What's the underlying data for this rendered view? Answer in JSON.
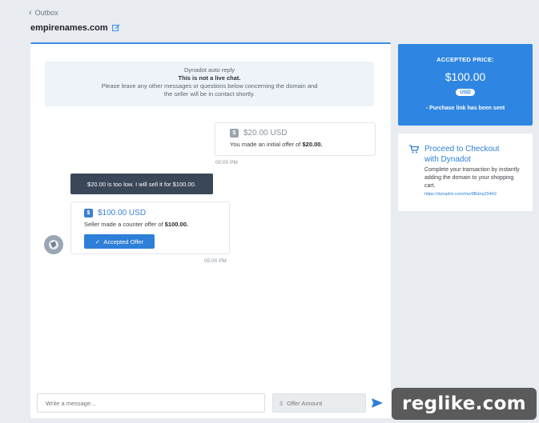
{
  "nav": {
    "back_label": "Outbox"
  },
  "header": {
    "domain": "empirenames.com"
  },
  "chat": {
    "auto_reply": {
      "title": "Dynadot auto reply",
      "notice": "This is not a live chat.",
      "body_line1": "Please leave any other messages or questions below concerning the domain and",
      "body_line2": "the seller will be in contact shortly."
    },
    "buyer_offer": {
      "price": "$20.00 USD",
      "text_prefix": "You made an initial offer of ",
      "text_amount": "$20.00.",
      "time": "00:00 PM"
    },
    "seller_message": "$20.00 is too low. I will sell it for $100.00.",
    "counter_offer": {
      "price": "$100.00 USD",
      "text_prefix": "Seller made a counter offer of ",
      "text_amount": "$100.00.",
      "button_label": "Accepted Offer",
      "time": "05:00 PM"
    },
    "composer": {
      "message_placeholder": "Write a message...",
      "offer_placeholder": "Offer Amount",
      "currency_symbol": "$"
    }
  },
  "sidebar": {
    "accepted": {
      "label": "ACCEPTED PRICE:",
      "amount": "$100.00",
      "currency": "USD",
      "status": "- Purchase link has been sent"
    },
    "checkout": {
      "title_line1": "Proceed to Checkout",
      "title_line2": "with Dynadot",
      "description": "Complete your transaction by instantly adding the domain to your shopping cart.",
      "link": "https://dynadot.com/me/8Bdnq29442"
    }
  },
  "watermark": "reglike.com",
  "colors": {
    "accent": "#2e86e2",
    "dark_bubble": "#3a4758",
    "background": "#e8ecf1"
  },
  "icons": [
    "chevron-left-icon",
    "edit-icon",
    "dollar-tag-icon",
    "check-icon",
    "avatar-icon",
    "send-icon",
    "cart-icon"
  ]
}
